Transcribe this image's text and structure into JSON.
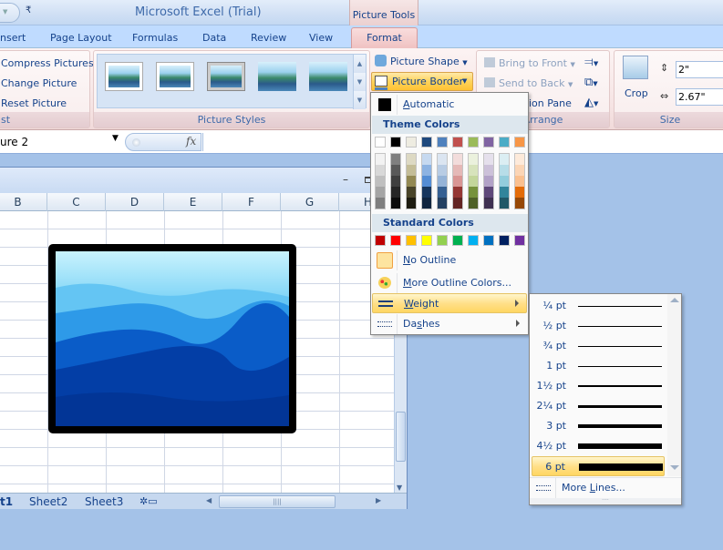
{
  "titlebar": {
    "app_title": "Microsoft Excel (Trial)",
    "context_group": "Picture Tools",
    "qat_more_icon": "customize-quick-access-icon"
  },
  "tabs": {
    "items": [
      "nsert",
      "Page Layout",
      "Formulas",
      "Data",
      "Review",
      "View"
    ],
    "active": "Format"
  },
  "ribbon": {
    "adjust": {
      "compress": "Compress Pictures",
      "change": "Change Picture",
      "reset": "Reset Picture",
      "label": "st"
    },
    "picture_styles": {
      "label": "Picture Styles"
    },
    "shape": "Picture Shape",
    "border": "Picture Border",
    "arrange": {
      "bring_front": "Bring to Front",
      "send_back": "Send to Back",
      "selection_pane": "ion Pane",
      "label": "Arrange"
    },
    "size": {
      "crop": "Crop",
      "height": "2\"",
      "width": "2.67\"",
      "label": "Size"
    }
  },
  "formula_bar": {
    "name_box": "ure 2",
    "fx": "fx",
    "value": ""
  },
  "sheet": {
    "columns": [
      "B",
      "C",
      "D",
      "E",
      "F",
      "G",
      "H"
    ],
    "tabs": [
      "t1",
      "Sheet2",
      "Sheet3"
    ],
    "active_tab": "t1"
  },
  "border_menu": {
    "automatic": "Automatic",
    "theme_colors_title": "Theme Colors",
    "theme_top": [
      "#ffffff",
      "#000000",
      "#eeece1",
      "#1f497d",
      "#4f81bd",
      "#c0504d",
      "#9bbb59",
      "#8064a2",
      "#4bacc6",
      "#f79646"
    ],
    "theme_shades": [
      [
        "#f2f2f2",
        "#d8d8d8",
        "#bfbfbf",
        "#a5a5a5",
        "#7f7f7f"
      ],
      [
        "#7f7f7f",
        "#595959",
        "#3f3f3f",
        "#262626",
        "#0c0c0c"
      ],
      [
        "#ddd9c3",
        "#c4bd97",
        "#938953",
        "#494429",
        "#1d1b10"
      ],
      [
        "#c6d9f0",
        "#8db3e2",
        "#548dd4",
        "#17365d",
        "#0f243e"
      ],
      [
        "#dbe5f1",
        "#b8cce4",
        "#95b3d7",
        "#366092",
        "#244061"
      ],
      [
        "#f2dcdb",
        "#e5b9b7",
        "#d99694",
        "#953734",
        "#632423"
      ],
      [
        "#ebf1dd",
        "#d7e3bc",
        "#c3d69b",
        "#76923c",
        "#4f6128"
      ],
      [
        "#e5e0ec",
        "#ccc1d9",
        "#b2a2c7",
        "#5f497a",
        "#3f3151"
      ],
      [
        "#dbeef3",
        "#b7dde8",
        "#92cddc",
        "#31859b",
        "#205867"
      ],
      [
        "#fdeada",
        "#fbd5b5",
        "#fac08f",
        "#e36c09",
        "#974806"
      ]
    ],
    "standard_colors_title": "Standard Colors",
    "standard": [
      "#c00000",
      "#ff0000",
      "#ffc000",
      "#ffff00",
      "#92d050",
      "#00b050",
      "#00b0f0",
      "#0070c0",
      "#002060",
      "#7030a0"
    ],
    "no_outline": "No Outline",
    "more_colors": "More Outline Colors...",
    "weight": "Weight",
    "dashes": "Dashes"
  },
  "weight_menu": {
    "items": [
      "¼ pt",
      "½ pt",
      "¾ pt",
      "1 pt",
      "1½ pt",
      "2¼ pt",
      "3 pt",
      "4½ pt",
      "6 pt"
    ],
    "weights_pt": [
      0.25,
      0.5,
      0.75,
      1,
      1.5,
      2.25,
      3,
      4.5,
      6
    ],
    "selected": "6 pt",
    "more_lines": "More Lines..."
  }
}
